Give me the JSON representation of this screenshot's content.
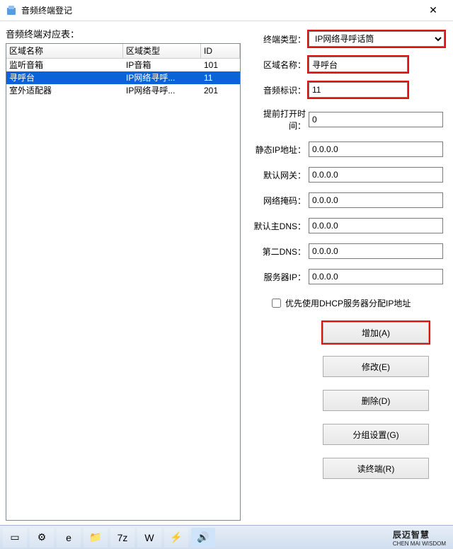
{
  "window": {
    "title": "音频终端登记",
    "close": "✕"
  },
  "left": {
    "label": "音频终端对应表：",
    "headers": {
      "c1": "区域名称",
      "c2": "区域类型",
      "c3": "ID"
    },
    "rows": [
      {
        "c1": "监听音箱",
        "c2": "IP音箱",
        "c3": "101",
        "selected": false
      },
      {
        "c1": "寻呼台",
        "c2": "IP网络寻呼...",
        "c3": "11",
        "selected": true
      },
      {
        "c1": "室外适配器",
        "c2": "IP网络寻呼...",
        "c3": "201",
        "selected": false
      }
    ]
  },
  "form": {
    "terminal_type": {
      "label": "终端类型：",
      "value": "IP网络寻呼话筒"
    },
    "area_name": {
      "label": "区域名称：",
      "value": "寻呼台"
    },
    "audio_id": {
      "label": "音频标识：",
      "value": "11"
    },
    "preopen": {
      "label": "提前打开时间：",
      "value": "0"
    },
    "static_ip": {
      "label": "静态IP地址：",
      "value": "0.0.0.0"
    },
    "gateway": {
      "label": "默认网关：",
      "value": "0.0.0.0"
    },
    "netmask": {
      "label": "网络掩码：",
      "value": "0.0.0.0"
    },
    "dns1": {
      "label": "默认主DNS：",
      "value": "0.0.0.0"
    },
    "dns2": {
      "label": "第二DNS：",
      "value": "0.0.0.0"
    },
    "server_ip": {
      "label": "服务器IP：",
      "value": "0.0.0.0"
    },
    "dhcp": {
      "label": "优先使用DHCP服务器分配IP地址",
      "checked": false
    }
  },
  "buttons": {
    "add": "增加(A)",
    "modify": "修改(E)",
    "delete": "删除(D)",
    "group": "分组设置(G)",
    "read": "读终端(R)"
  },
  "taskbar": {
    "items": [
      "▭",
      "⚙",
      "e",
      "📁",
      "7z",
      "W",
      "⚡",
      "🔊"
    ],
    "brand": "辰迈智慧",
    "brand_sub": "CHEN MAI WISDOM"
  }
}
